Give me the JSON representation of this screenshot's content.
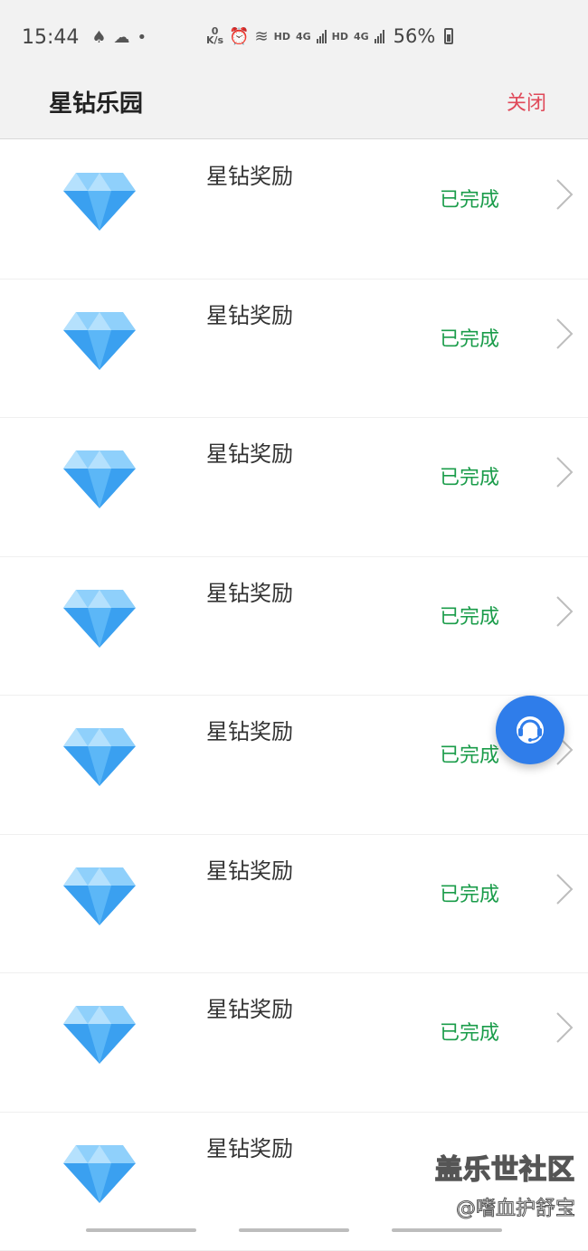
{
  "status_bar": {
    "time": "15:44",
    "speed_value": "0",
    "speed_unit": "K/s",
    "hd1": "HD",
    "net1": "4G",
    "hd2": "HD",
    "net2": "4G",
    "battery": "56%"
  },
  "header": {
    "title": "星钻乐园",
    "close_label": "关闭"
  },
  "items": [
    {
      "title": "星钻奖励",
      "status": "已完成"
    },
    {
      "title": "星钻奖励",
      "status": "已完成"
    },
    {
      "title": "星钻奖励",
      "status": "已完成"
    },
    {
      "title": "星钻奖励",
      "status": "已完成"
    },
    {
      "title": "星钻奖励",
      "status": "已完成"
    },
    {
      "title": "星钻奖励",
      "status": "已完成"
    },
    {
      "title": "星钻奖励",
      "status": "已完成"
    },
    {
      "title": "星钻奖励",
      "status": ""
    }
  ],
  "watermark": {
    "title": "盖乐世社区",
    "sub": "@嗜血护舒宝"
  },
  "colors": {
    "accent_close": "#e04a5a",
    "status_done": "#1a9c4a",
    "diamond": "#3aa0f0",
    "fab": "#2f7dea"
  },
  "icons": {
    "diamond": "diamond-icon",
    "chevron": "chevron-right-icon",
    "support": "customer-service-headset-icon"
  }
}
